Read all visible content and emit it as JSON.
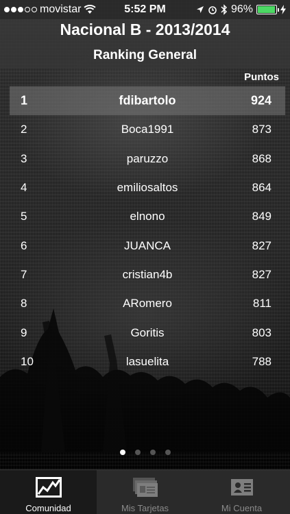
{
  "status": {
    "carrier": "movistar",
    "time": "5:52 PM",
    "battery": "96%",
    "battery_level": 0.96
  },
  "header": {
    "title": "Nacional B - 2013/2014",
    "subtitle": "Ranking General"
  },
  "table": {
    "points_header": "Puntos",
    "rows": [
      {
        "rank": "1",
        "name": "fdibartolo",
        "points": "924",
        "highlighted": true
      },
      {
        "rank": "2",
        "name": "Boca1991",
        "points": "873"
      },
      {
        "rank": "3",
        "name": "paruzzo",
        "points": "868"
      },
      {
        "rank": "4",
        "name": "emiliosaltos",
        "points": "864"
      },
      {
        "rank": "5",
        "name": "elnono",
        "points": "849"
      },
      {
        "rank": "6",
        "name": "JUANCA",
        "points": "827"
      },
      {
        "rank": "7",
        "name": "cristian4b",
        "points": "827"
      },
      {
        "rank": "8",
        "name": "ARomero",
        "points": "811"
      },
      {
        "rank": "9",
        "name": "Goritis",
        "points": "803"
      },
      {
        "rank": "10",
        "name": "lasuelita",
        "points": "788"
      }
    ]
  },
  "pager": {
    "pages": 4,
    "current": 1
  },
  "tabs": [
    {
      "label": "Comunidad",
      "icon": "chart-icon",
      "active": true
    },
    {
      "label": "Mis Tarjetas",
      "icon": "cards-icon",
      "active": false
    },
    {
      "label": "Mi Cuenta",
      "icon": "account-card-icon",
      "active": false
    }
  ],
  "colors": {
    "battery": "#4cd964",
    "highlight_row": "#787878",
    "tab_inactive": "#8a8a8a"
  }
}
